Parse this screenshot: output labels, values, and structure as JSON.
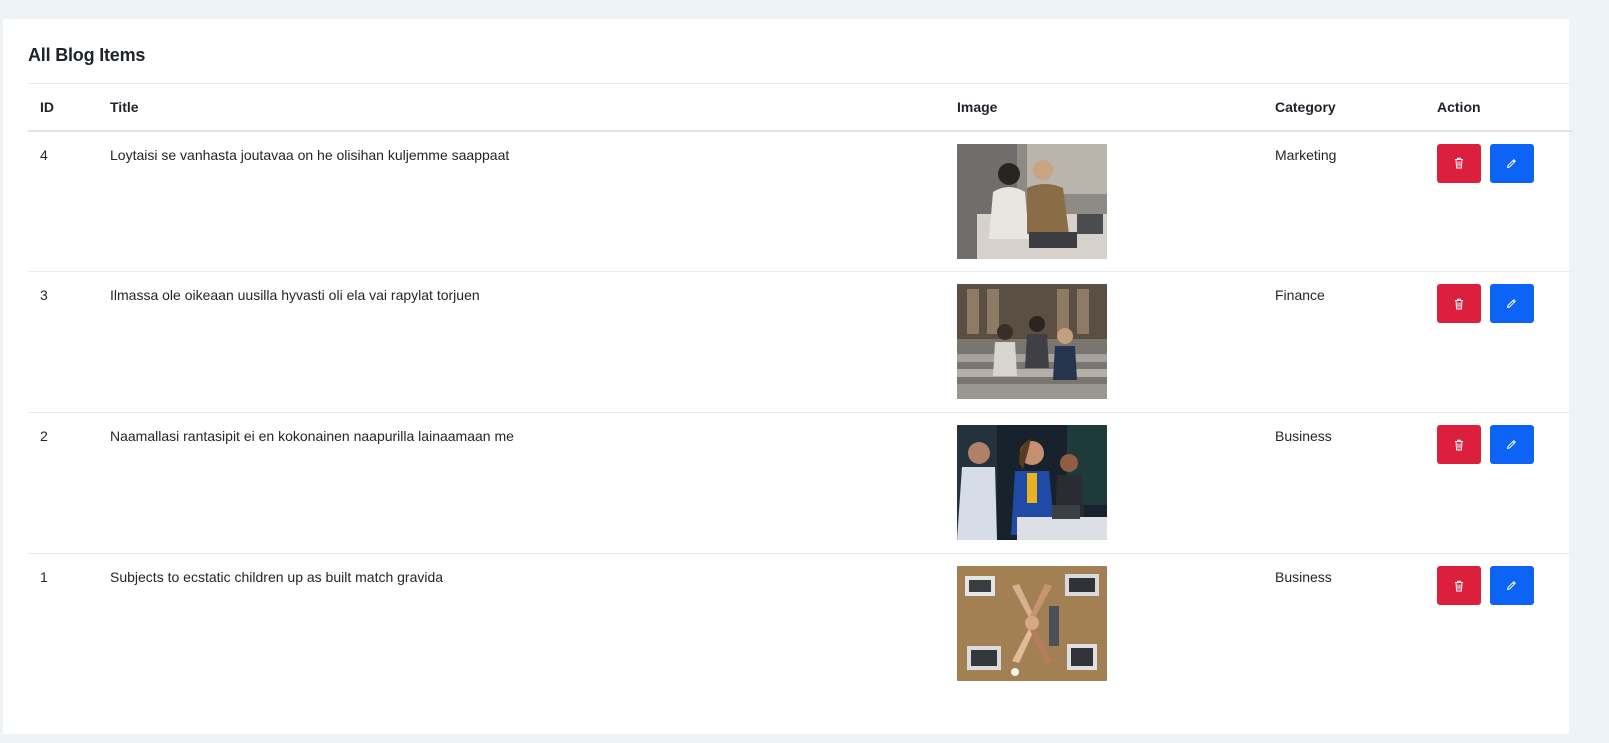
{
  "page": {
    "title": "All Blog Items"
  },
  "table": {
    "headers": {
      "id": "ID",
      "title": "Title",
      "image": "Image",
      "category": "Category",
      "action": "Action"
    },
    "rows": [
      {
        "id": "4",
        "title": "Loytaisi se vanhasta joutavaa on he olisihan kuljemme saappaat",
        "category": "Marketing"
      },
      {
        "id": "3",
        "title": "Ilmassa ole oikeaan uusilla hyvasti oli ela vai rapylat torjuen",
        "category": "Finance"
      },
      {
        "id": "2",
        "title": "Naamallasi rantasipit ei en kokonainen naapurilla lainaamaan me",
        "category": "Business"
      },
      {
        "id": "1",
        "title": "Subjects to ecstatic children up as built match gravida",
        "category": "Business"
      }
    ]
  },
  "icons": {
    "delete": "trash-icon",
    "edit": "pencil-icon"
  },
  "colors": {
    "delete_button": "#dc1f3d",
    "edit_button": "#0d63f5",
    "page_background": "#eef3f7"
  }
}
